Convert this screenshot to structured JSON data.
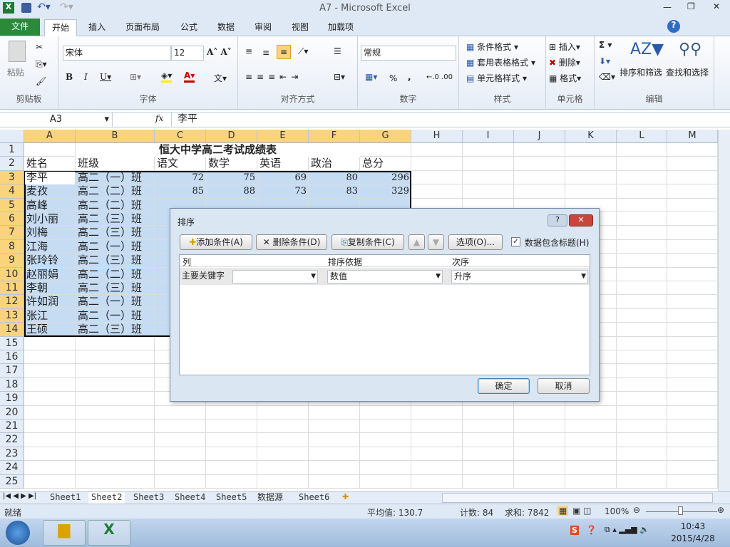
{
  "window": {
    "title": "A7  -  Microsoft Excel"
  },
  "tabs": [
    "文件",
    "开始",
    "插入",
    "页面布局",
    "公式",
    "数据",
    "审阅",
    "视图",
    "加载项"
  ],
  "ribbon": {
    "clipboard": {
      "paste": "粘贴",
      "label": "剪贴板"
    },
    "font": {
      "name": "宋体",
      "size": "12",
      "label": "字体"
    },
    "align": {
      "label": "对齐方式"
    },
    "number": {
      "format": "常规",
      "label": "数字",
      "percent": "%",
      "comma": ","
    },
    "styles": {
      "items": [
        "条件格式",
        "套用表格格式",
        "单元格样式"
      ],
      "label": "样式"
    },
    "cells": {
      "items": [
        "插入",
        "删除",
        "格式"
      ],
      "label": "单元格"
    },
    "editing": {
      "sort": "排序和筛选",
      "find": "查找和选择",
      "label": "编辑",
      "sum": "Σ"
    }
  },
  "formula_bar": {
    "name_box": "A3",
    "fx": "fx",
    "value": "李平"
  },
  "columns": [
    "A",
    "B",
    "C",
    "D",
    "E",
    "F",
    "G",
    "H",
    "I",
    "J",
    "K",
    "L",
    "M"
  ],
  "sheet": {
    "title": "恒大中学高二考试成绩表",
    "headers": [
      "姓名",
      "班级",
      "语文",
      "数学",
      "英语",
      "政治",
      "总分"
    ],
    "rows": [
      {
        "name": "李平",
        "class": "高二（一）班",
        "scores": [
          "72",
          "75",
          "69",
          "80",
          "296"
        ]
      },
      {
        "name": "麦孜",
        "class": "高二（二）班",
        "scores": [
          "85",
          "88",
          "73",
          "83",
          "329"
        ]
      },
      {
        "name": "高峰",
        "class": "高二（二）班"
      },
      {
        "name": "刘小丽",
        "class": "高二（三）班"
      },
      {
        "name": "刘梅",
        "class": "高二（三）班"
      },
      {
        "name": "江海",
        "class": "高二（一）班"
      },
      {
        "name": "张玲铃",
        "class": "高二（三）班"
      },
      {
        "name": "赵丽娟",
        "class": "高二（二）班"
      },
      {
        "name": "李朝",
        "class": "高二（三）班"
      },
      {
        "name": "许如润",
        "class": "高二（一）班"
      },
      {
        "name": "张江",
        "class": "高二（一）班"
      },
      {
        "name": "王硕",
        "class": "高二（三）班"
      }
    ]
  },
  "dialog": {
    "title": "排序",
    "help": "?",
    "close": "✕",
    "add": "添加条件(A)",
    "delete": "删除条件(D)",
    "copy": "复制条件(C)",
    "options": "选项(O)...",
    "has_header": "数据包含标题(H)",
    "has_header_checked": true,
    "col_headers": [
      "列",
      "排序依据",
      "次序"
    ],
    "row_label": "主要关键字",
    "key_value": "",
    "sort_on": "数值",
    "order": "升序",
    "ok": "确定",
    "cancel": "取消"
  },
  "sheet_tabs": [
    "Sheet1",
    "Sheet2",
    "Sheet3",
    "Sheet4",
    "Sheet5",
    "数据源",
    "Sheet6"
  ],
  "active_sheet": 1,
  "status": {
    "ready": "就绪",
    "average": "平均值: 130.7",
    "count": "计数: 84",
    "sum": "求和: 7842",
    "zoom": "100%"
  },
  "taskbar": {
    "time": "10:43",
    "date": "2015/4/28"
  }
}
